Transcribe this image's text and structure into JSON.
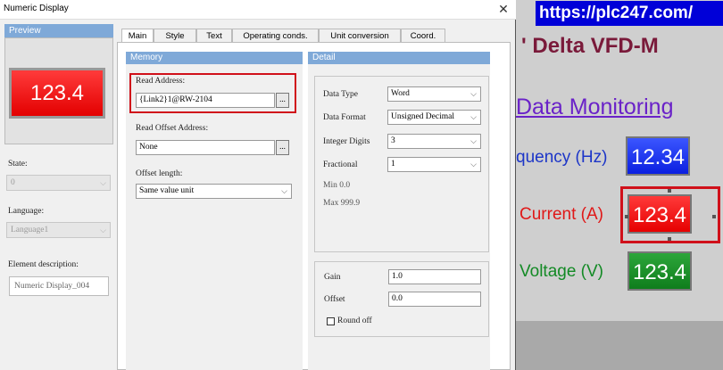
{
  "dialog": {
    "title": "Numeric Display",
    "close_icon": "close-icon"
  },
  "preview": {
    "header": "Preview",
    "value": "123.4"
  },
  "sidebar": {
    "state_label": "State:",
    "state_value": "0",
    "language_label": "Language:",
    "language_value": "Language1",
    "description_label": "Element description:",
    "description_value": "Numeric Display_004"
  },
  "tabs": [
    "Main",
    "Style",
    "Text",
    "Operating conds.",
    "Unit conversion",
    "Coord."
  ],
  "memory": {
    "header": "Memory",
    "read_address_label": "Read Address:",
    "read_address_value": "{Link2}1@RW-2104",
    "read_offset_label": "Read Offset Address:",
    "read_offset_value": "None",
    "offset_length_label": "Offset length:",
    "offset_length_value": "Same value unit",
    "browse_label": "..."
  },
  "detail": {
    "header": "Detail",
    "data_type_label": "Data Type",
    "data_type_value": "Word",
    "data_format_label": "Data Format",
    "data_format_value": "Unsigned Decimal",
    "integer_digits_label": "Integer Digits",
    "integer_digits_value": "3",
    "fractional_label": "Fractional",
    "fractional_value": "1",
    "min_text": "Min 0.0",
    "max_text": "Max 999.9",
    "gain_label": "Gain",
    "gain_value": "1.0",
    "offset_label": "Offset",
    "offset_value": "0.0",
    "round_off_label": "Round off"
  },
  "background_app": {
    "url": "https://plc247.com/",
    "title": "' Delta VFD-M",
    "subtitle": "Data Monitoring",
    "frequency_label": "quency (Hz)",
    "frequency_value": "12.34",
    "current_label": "Current (A)",
    "current_value": "123.4",
    "voltage_label": "Voltage (V)",
    "voltage_value": "123.4",
    "colors": {
      "frequency": "#1c35c8",
      "current": "#e01818",
      "voltage": "#138a25",
      "url_bar": "#0000d8"
    }
  }
}
